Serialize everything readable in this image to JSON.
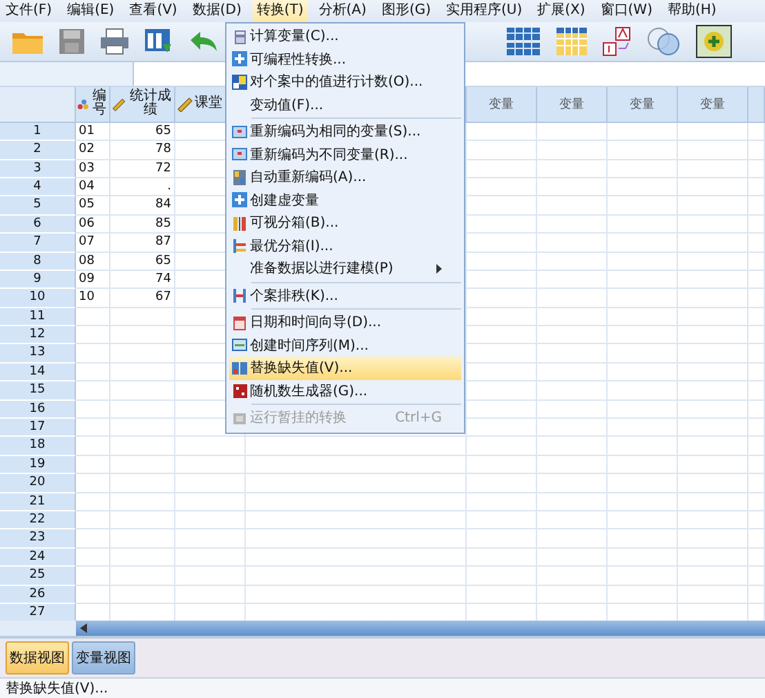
{
  "menu_bar": [
    {
      "label": "文件(F)",
      "selected": false
    },
    {
      "label": "编辑(E)",
      "selected": false
    },
    {
      "label": "查看(V)",
      "selected": false
    },
    {
      "label": "数据(D)",
      "selected": false
    },
    {
      "label": "转换(T)",
      "selected": true
    },
    {
      "label": "分析(A)",
      "selected": false
    },
    {
      "label": "图形(G)",
      "selected": false
    },
    {
      "label": "实用程序(U)",
      "selected": false
    },
    {
      "label": "扩展(X)",
      "selected": false
    },
    {
      "label": "窗口(W)",
      "selected": false
    },
    {
      "label": "帮助(H)",
      "selected": false
    }
  ],
  "open_menu": {
    "items": [
      {
        "kind": "command",
        "label": "计算变量(C)...",
        "selected": false,
        "disabled": false
      },
      {
        "kind": "command",
        "label": "可编程性转换...",
        "selected": false,
        "disabled": false
      },
      {
        "kind": "command",
        "label": "对个案中的值进行计数(O)...",
        "selected": false,
        "disabled": false
      },
      {
        "kind": "command",
        "label": "变动值(F)...",
        "selected": false,
        "disabled": false
      },
      {
        "kind": "separator"
      },
      {
        "kind": "command",
        "label": "重新编码为相同的变量(S)...",
        "selected": false,
        "disabled": false
      },
      {
        "kind": "command",
        "label": "重新编码为不同变量(R)...",
        "selected": false,
        "disabled": false
      },
      {
        "kind": "command",
        "label": "自动重新编码(A)...",
        "selected": false,
        "disabled": false
      },
      {
        "kind": "command",
        "label": "创建虚变量",
        "selected": false,
        "disabled": false
      },
      {
        "kind": "command",
        "label": "可视分箱(B)...",
        "selected": false,
        "disabled": false
      },
      {
        "kind": "command",
        "label": "最优分箱(I)...",
        "selected": false,
        "disabled": false
      },
      {
        "kind": "submenu",
        "label": "准备数据以进行建模(P)",
        "selected": false,
        "disabled": false
      },
      {
        "kind": "separator"
      },
      {
        "kind": "command",
        "label": "个案排秩(K)...",
        "selected": false,
        "disabled": false
      },
      {
        "kind": "separator"
      },
      {
        "kind": "command",
        "label": "日期和时间向导(D)...",
        "selected": false,
        "disabled": false
      },
      {
        "kind": "command",
        "label": "创建时间序列(M)...",
        "selected": false,
        "disabled": false
      },
      {
        "kind": "command",
        "label": "替换缺失值(V)...",
        "selected": true,
        "disabled": false
      },
      {
        "kind": "command",
        "label": "随机数生成器(G)...",
        "selected": false,
        "disabled": false
      },
      {
        "kind": "separator"
      },
      {
        "kind": "command",
        "label": "运行暂挂的转换",
        "shortcut": "Ctrl+G",
        "selected": false,
        "disabled": true
      }
    ]
  },
  "grid": {
    "columns": [
      {
        "name": "编号",
        "kind": "nominal"
      },
      {
        "name": "统计成绩",
        "kind": "scale"
      },
      {
        "name": "课堂",
        "kind": "scale"
      }
    ],
    "empty_columns": [
      "变量",
      "变量",
      "变量",
      "变量"
    ],
    "rows": [
      {
        "number": "1",
        "cells": [
          "01",
          "65"
        ]
      },
      {
        "number": "2",
        "cells": [
          "02",
          "78"
        ]
      },
      {
        "number": "3",
        "cells": [
          "03",
          "72"
        ]
      },
      {
        "number": "4",
        "cells": [
          "04",
          "."
        ]
      },
      {
        "number": "5",
        "cells": [
          "05",
          "84"
        ]
      },
      {
        "number": "6",
        "cells": [
          "06",
          "85"
        ]
      },
      {
        "number": "7",
        "cells": [
          "07",
          "87"
        ]
      },
      {
        "number": "8",
        "cells": [
          "08",
          "65"
        ]
      },
      {
        "number": "9",
        "cells": [
          "09",
          "74"
        ]
      },
      {
        "number": "10",
        "cells": [
          "10",
          "67"
        ]
      },
      {
        "number": "11",
        "cells": []
      },
      {
        "number": "12",
        "cells": []
      },
      {
        "number": "13",
        "cells": []
      },
      {
        "number": "14",
        "cells": []
      },
      {
        "number": "15",
        "cells": []
      },
      {
        "number": "16",
        "cells": []
      },
      {
        "number": "17",
        "cells": []
      },
      {
        "number": "18",
        "cells": []
      },
      {
        "number": "19",
        "cells": []
      },
      {
        "number": "20",
        "cells": []
      },
      {
        "number": "21",
        "cells": []
      },
      {
        "number": "22",
        "cells": []
      },
      {
        "number": "23",
        "cells": []
      },
      {
        "number": "24",
        "cells": []
      },
      {
        "number": "25",
        "cells": []
      },
      {
        "number": "26",
        "cells": []
      },
      {
        "number": "27",
        "cells": []
      }
    ]
  },
  "view_tabs": [
    {
      "label": "数据视图",
      "selected": true
    },
    {
      "label": "变量视图",
      "selected": false
    }
  ],
  "status_bar": "替换缺失值(V)..."
}
